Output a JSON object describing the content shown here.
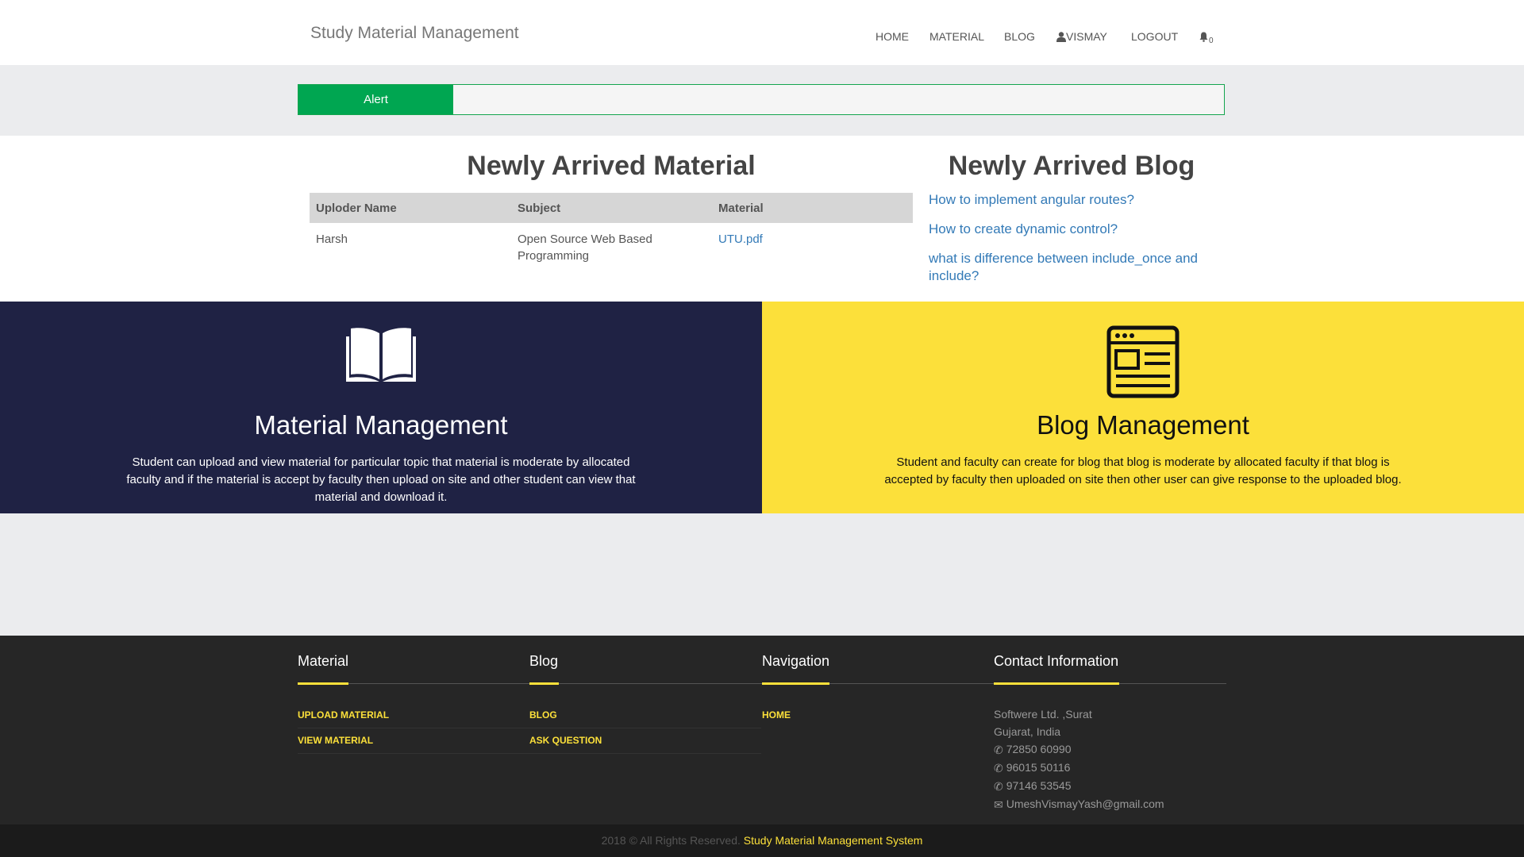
{
  "header": {
    "brand": "Study Material Management",
    "nav": {
      "home": "HOME",
      "material": "MATERIAL",
      "blog": "BLOG",
      "user": "VISMAY",
      "logout": "LOGOUT",
      "notifications_count": "0"
    }
  },
  "alert": {
    "label": "Alert"
  },
  "materials": {
    "title": "Newly Arrived Material",
    "columns": [
      "Uploder Name",
      "Subject",
      "Material"
    ],
    "rows": [
      {
        "uploader": "Harsh",
        "subject": "Open Source Web Based Programming",
        "material": "UTU.pdf"
      }
    ]
  },
  "blogs": {
    "title": "Newly Arrived Blog",
    "items": [
      "How to implement angular routes?",
      "How to create dynamic control?",
      "what is difference between include_once and include?"
    ]
  },
  "features": {
    "material": {
      "title": "Material Management",
      "text": "Student can upload and view material for particular topic that material is moderate by allocated faculty and if the material is accept by faculty then upload on site and other student can view that material and download it.",
      "icon": "book-open-icon"
    },
    "blog": {
      "title": "Blog Management",
      "text": "Student and faculty can create for blog that blog is moderate by allocated faculty if that blog is accepted by faculty then uploaded on site then other user can give response to the uploaded blog.",
      "icon": "browser-window-icon"
    }
  },
  "footer": {
    "material": {
      "title": "Material",
      "links": [
        "UPLOAD MATERIAL",
        "VIEW MATERIAL"
      ]
    },
    "blog": {
      "title": "Blog",
      "links": [
        "BLOG",
        "ASK QUESTION"
      ]
    },
    "navigation": {
      "title": "Navigation",
      "links": [
        "HOME"
      ]
    },
    "contact": {
      "title": "Contact Information",
      "address1": "Softwere Ltd. ,Surat",
      "address2": "Gujarat, India",
      "phones": [
        "72850 60990",
        "96015 50116",
        "97146 53545"
      ],
      "email": "UmeshVismayYash@gmail.com"
    },
    "copyright": "2018 © All Rights Reserved.",
    "copyright_link": "Study Material Management System"
  },
  "colors": {
    "accent_yellow": "#fce03a",
    "navy": "#1f2244",
    "green": "#00a651",
    "footer": "#262626"
  }
}
